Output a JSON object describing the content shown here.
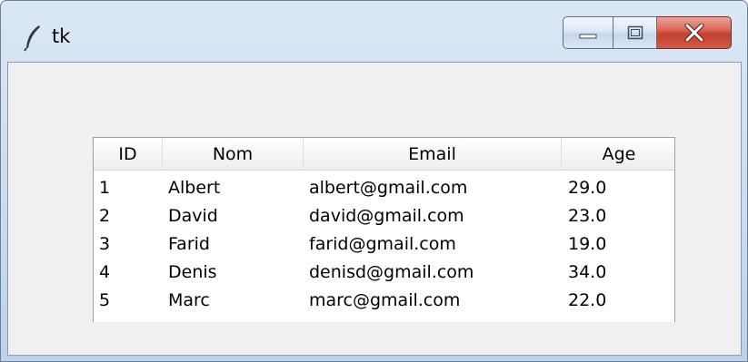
{
  "window": {
    "title": "tk"
  },
  "table": {
    "columns": [
      "ID",
      "Nom",
      "Email",
      "Age"
    ],
    "rows": [
      [
        "1",
        "Albert",
        "albert@gmail.com",
        "29.0"
      ],
      [
        "2",
        "David",
        "david@gmail.com",
        "23.0"
      ],
      [
        "3",
        "Farid",
        "farid@gmail.com",
        "19.0"
      ],
      [
        "4",
        "Denis",
        "denisd@gmail.com",
        "34.0"
      ],
      [
        "5",
        "Marc",
        "marc@gmail.com",
        "22.0"
      ]
    ]
  }
}
